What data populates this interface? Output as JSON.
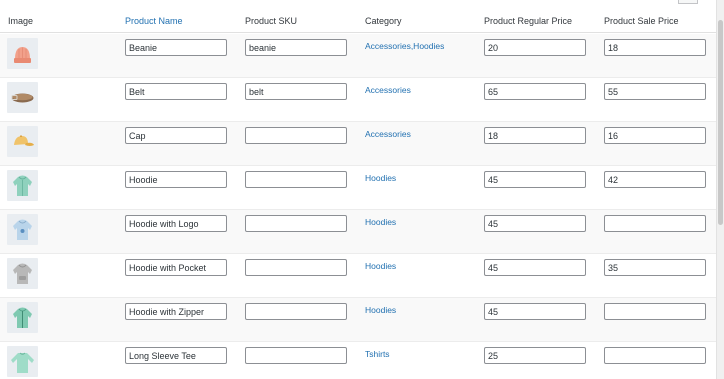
{
  "columns": {
    "image": "Image",
    "name": "Product Name",
    "sku": "Product SKU",
    "category": "Category",
    "regular_price": "Product Regular Price",
    "sale_price": "Product Sale Price"
  },
  "colors": {
    "link": "#2271b1",
    "row_alt": "#f9f9f9",
    "thumb_bg": "#e9edf1"
  },
  "rows": [
    {
      "thumbnail": "beanie-thumbnail",
      "name": "Beanie",
      "sku": "beanie",
      "category": "Accessories,Hoodies",
      "regular_price": "20",
      "sale_price": "18"
    },
    {
      "thumbnail": "belt-thumbnail",
      "name": "Belt",
      "sku": "belt",
      "category": "Accessories",
      "regular_price": "65",
      "sale_price": "55"
    },
    {
      "thumbnail": "cap-thumbnail",
      "name": "Cap",
      "sku": "",
      "category": "Accessories",
      "regular_price": "18",
      "sale_price": "16"
    },
    {
      "thumbnail": "hoodie-thumbnail",
      "name": "Hoodie",
      "sku": "",
      "category": "Hoodies",
      "regular_price": "45",
      "sale_price": "42"
    },
    {
      "thumbnail": "hoodie-logo-thumbnail",
      "name": "Hoodie with Logo",
      "sku": "",
      "category": "Hoodies",
      "regular_price": "45",
      "sale_price": ""
    },
    {
      "thumbnail": "hoodie-pocket-thumbnail",
      "name": "Hoodie with Pocket",
      "sku": "",
      "category": "Hoodies",
      "regular_price": "45",
      "sale_price": "35"
    },
    {
      "thumbnail": "hoodie-zipper-thumbnail",
      "name": "Hoodie with Zipper",
      "sku": "",
      "category": "Hoodies",
      "regular_price": "45",
      "sale_price": ""
    },
    {
      "thumbnail": "long-sleeve-tee-thumbnail",
      "name": "Long Sleeve Tee",
      "sku": "",
      "category": "Tshirts",
      "regular_price": "25",
      "sale_price": ""
    }
  ]
}
